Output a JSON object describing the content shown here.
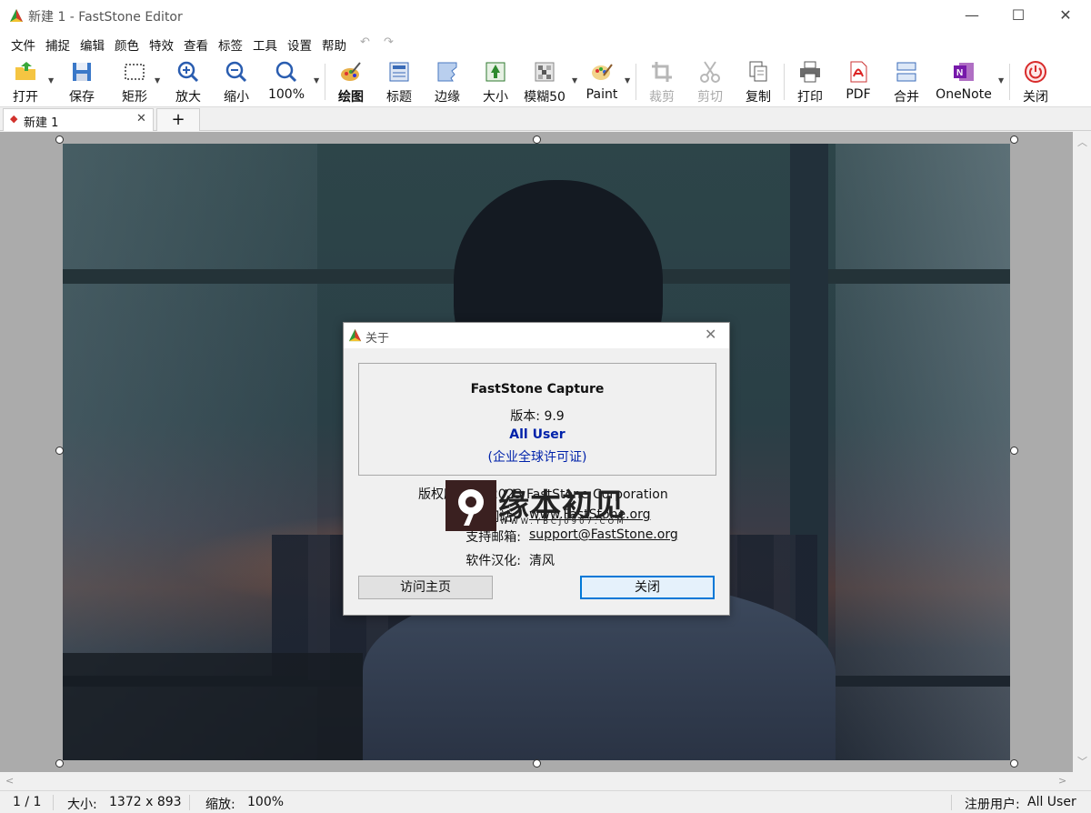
{
  "window": {
    "title": "新建 1 - FastStone Editor",
    "minimize": "—",
    "maximize": "☐",
    "close": "✕"
  },
  "menu": {
    "items": [
      "文件",
      "捕捉",
      "编辑",
      "颜色",
      "特效",
      "查看",
      "标签",
      "工具",
      "设置",
      "帮助"
    ],
    "undo_icon": "↶",
    "redo_icon": "↷"
  },
  "toolbar": {
    "items": [
      {
        "label": "打开",
        "icon": "open-folder-icon",
        "enabled": true
      },
      {
        "label": "保存",
        "icon": "save-icon",
        "enabled": true
      },
      {
        "label": "矩形",
        "icon": "rectangle-select-icon",
        "enabled": true
      },
      {
        "label": "放大",
        "icon": "zoom-in-icon",
        "enabled": true
      },
      {
        "label": "缩小",
        "icon": "zoom-out-icon",
        "enabled": true
      },
      {
        "label": "100%",
        "icon": "zoom-100-icon",
        "enabled": true
      },
      {
        "label": "绘图",
        "icon": "draw-icon",
        "enabled": true
      },
      {
        "label": "标题",
        "icon": "caption-icon",
        "enabled": true
      },
      {
        "label": "边缘",
        "icon": "edge-icon",
        "enabled": true
      },
      {
        "label": "大小",
        "icon": "resize-icon",
        "enabled": true
      },
      {
        "label": "模糊50",
        "icon": "blur-icon",
        "enabled": true
      },
      {
        "label": "Paint",
        "icon": "paint-palette-icon",
        "enabled": true
      },
      {
        "label": "裁剪",
        "icon": "crop-icon",
        "enabled": false
      },
      {
        "label": "剪切",
        "icon": "scissors-icon",
        "enabled": false
      },
      {
        "label": "复制",
        "icon": "copy-icon",
        "enabled": true
      },
      {
        "label": "打印",
        "icon": "printer-icon",
        "enabled": true
      },
      {
        "label": "PDF",
        "icon": "pdf-icon",
        "enabled": true
      },
      {
        "label": "合并",
        "icon": "merge-icon",
        "enabled": true
      },
      {
        "label": "OneNote",
        "icon": "onenote-icon",
        "enabled": true
      },
      {
        "label": "关闭",
        "icon": "power-icon",
        "enabled": true
      }
    ]
  },
  "tabs": {
    "active": {
      "label": "新建 1",
      "close": "✕"
    },
    "add": "+"
  },
  "status": {
    "page": "1 / 1",
    "size_label": "大小:",
    "size_value": "1372 x 893",
    "zoom_label": "缩放:",
    "zoom_value": "100%",
    "user_label": "注册用户:",
    "user_value": "All User"
  },
  "dialog": {
    "title": "关于",
    "close": "✕",
    "product": "FastStone Capture",
    "version": "版本: 9.9",
    "user": "All User",
    "license": "(企业全球许可证)",
    "copyright": "版权所有 © 2023 FastStone Corporation",
    "website_label": "网站:",
    "website": "www.FastStone.org",
    "email_label": "支持邮箱:",
    "email": "support@FastStone.org",
    "localization_label": "软件汉化:",
    "localization": "清风",
    "btn_home": "访问主页",
    "btn_close": "关闭"
  },
  "watermark": {
    "text": "缘本初见",
    "url": "WWW.YBCJ0907.COM"
  },
  "colors": {
    "accent": "#0078d7",
    "link_blue": "#0022aa",
    "close_red": "#d2322d"
  }
}
